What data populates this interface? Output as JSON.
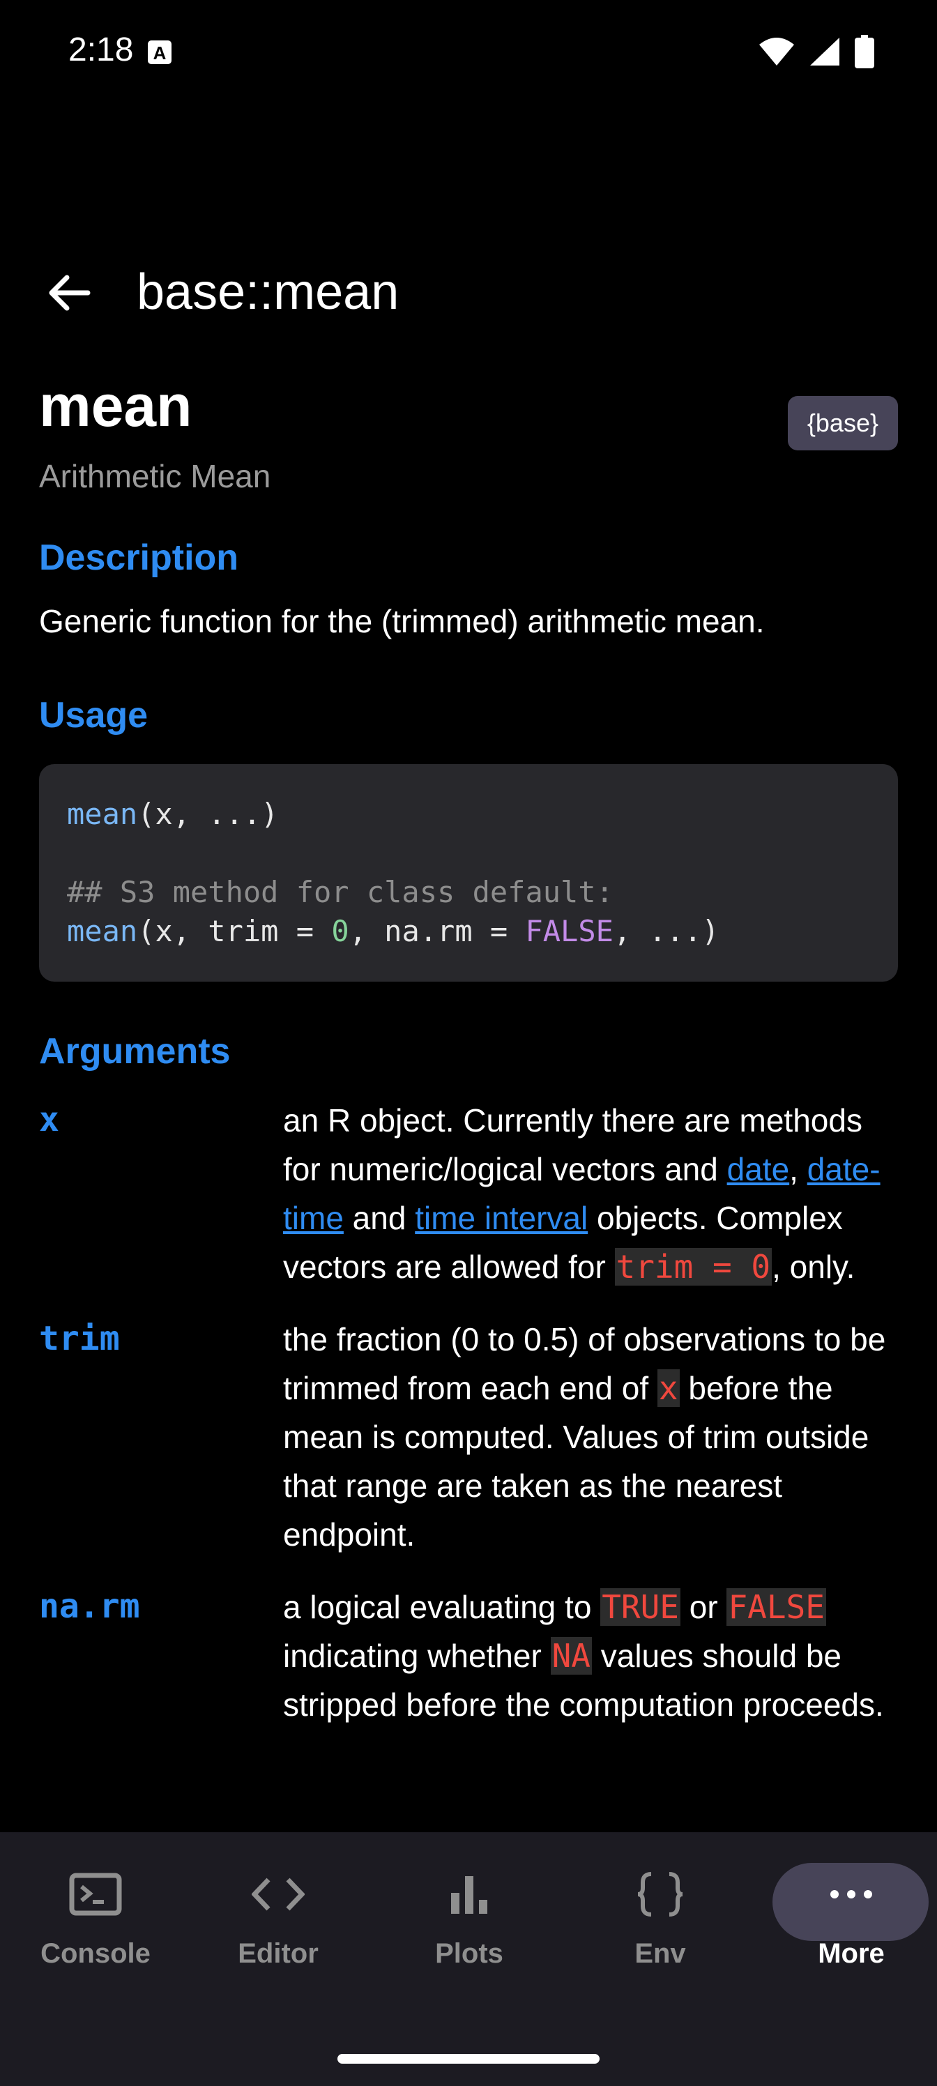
{
  "status_bar": {
    "time": "2:18",
    "notification_icon": "a-notification-icon",
    "icons": [
      "wifi-icon",
      "signal-icon",
      "battery-icon"
    ]
  },
  "app_bar": {
    "title": "base::mean",
    "back_icon": "arrow-back-icon"
  },
  "doc": {
    "name": "mean",
    "package": "{base}",
    "subtitle": "Arithmetic Mean",
    "description_heading": "Description",
    "description": "Generic function for the (trimmed) arithmetic mean.",
    "usage_heading": "Usage",
    "usage": {
      "line1_fn": "mean",
      "line1_rest": "(x, ...)",
      "comment": "## S3 method for class default:",
      "line2_fn": "mean",
      "line2_a": "(x, trim = ",
      "line2_num": "0",
      "line2_b": ", na.rm = ",
      "line2_lg": "FALSE",
      "line2_c": ", ...)"
    },
    "arguments_heading": "Arguments",
    "args": {
      "x": {
        "name": "x",
        "t1": "an R object. Currently there are methods for numeric/logical vectors and ",
        "link1": "date",
        "t2": ", ",
        "link2": "date-time",
        "t3": " and ",
        "link3": "time interval",
        "t4": " objects. Complex vectors are allowed for ",
        "code1": "trim = 0",
        "t5": ", only."
      },
      "trim": {
        "name": "trim",
        "t1": "the fraction (0 to 0.5) of observations to be trimmed from each end of ",
        "code1": "x",
        "t2": " before the mean is computed. Values of trim outside that range are taken as the nearest endpoint."
      },
      "narm": {
        "name": "na.rm",
        "t1": "a logical evaluating to ",
        "code1": "TRUE",
        "t2": " or ",
        "code2": "FALSE",
        "t3": " indicating whether ",
        "code3": "NA",
        "t4": " values should be stripped before the computation proceeds."
      }
    }
  },
  "bottom_nav": [
    {
      "label": "Console",
      "icon": "terminal-icon"
    },
    {
      "label": "Editor",
      "icon": "code-icon"
    },
    {
      "label": "Plots",
      "icon": "bar-chart-icon"
    },
    {
      "label": "Env",
      "icon": "braces-icon"
    },
    {
      "label": "More",
      "icon": "more-horizontal-icon",
      "selected": true
    }
  ],
  "colors": {
    "accent": "#2f8cf2",
    "code_inline": "#f0483e",
    "nav_bg": "#1c1b22",
    "pill": "#474458"
  }
}
